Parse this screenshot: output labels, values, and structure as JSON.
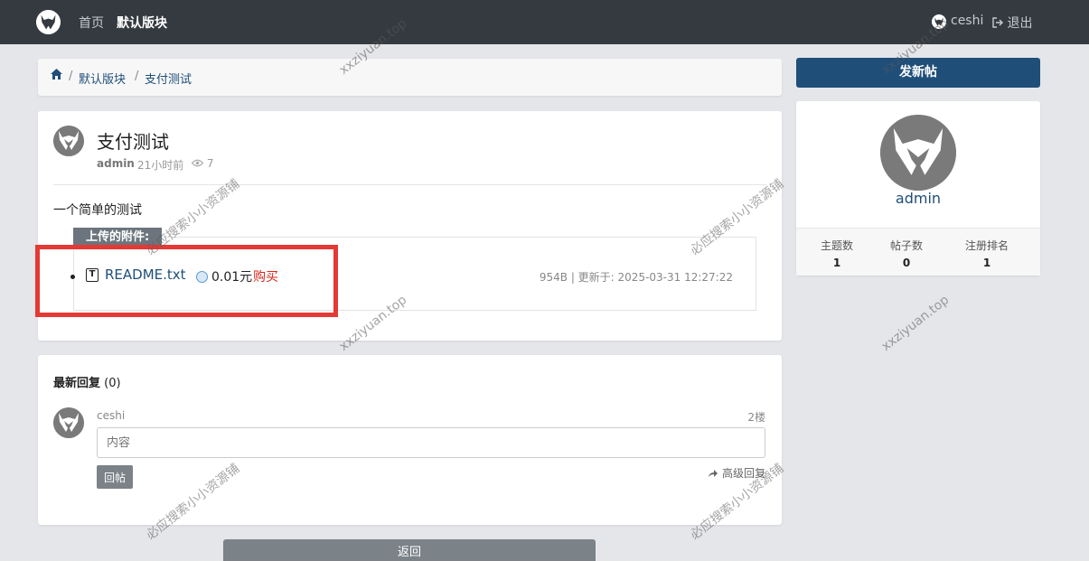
{
  "nav": {
    "home": "首页",
    "forum": "默认版块",
    "user": "ceshi",
    "logout": "退出"
  },
  "breadcrumb": {
    "forum": "默认版块",
    "thread": "支付测试"
  },
  "thread": {
    "title": "支付测试",
    "author": "admin",
    "time": "21小时前",
    "views": "7",
    "body": "一个简单的测试",
    "attachments_label": "上传的附件:",
    "attachment": {
      "name": "README.txt",
      "icon_letter": "T",
      "price": "0.01元",
      "buy": "购买",
      "meta": "954B | 更新于: 2025-03-31 12:27:22"
    }
  },
  "replies": {
    "title": "最新回复",
    "count": "(0)",
    "user": "ceshi",
    "floor": "2楼",
    "placeholder": "内容",
    "submit": "回帖",
    "advanced": "高级回复"
  },
  "back": "返回",
  "sidebar": {
    "new_thread": "发新帖",
    "profile_name": "admin",
    "stats": [
      {
        "label": "主题数",
        "value": "1"
      },
      {
        "label": "帖子数",
        "value": "0"
      },
      {
        "label": "注册排名",
        "value": "1"
      }
    ]
  },
  "watermarks": {
    "site": "xxziyuan.top",
    "shop": "必应搜索小小资源铺"
  },
  "colors": {
    "navbar": "#343a40",
    "primary": "#1f4e79",
    "buy": "#d9261c",
    "highlight": "#e53935"
  }
}
